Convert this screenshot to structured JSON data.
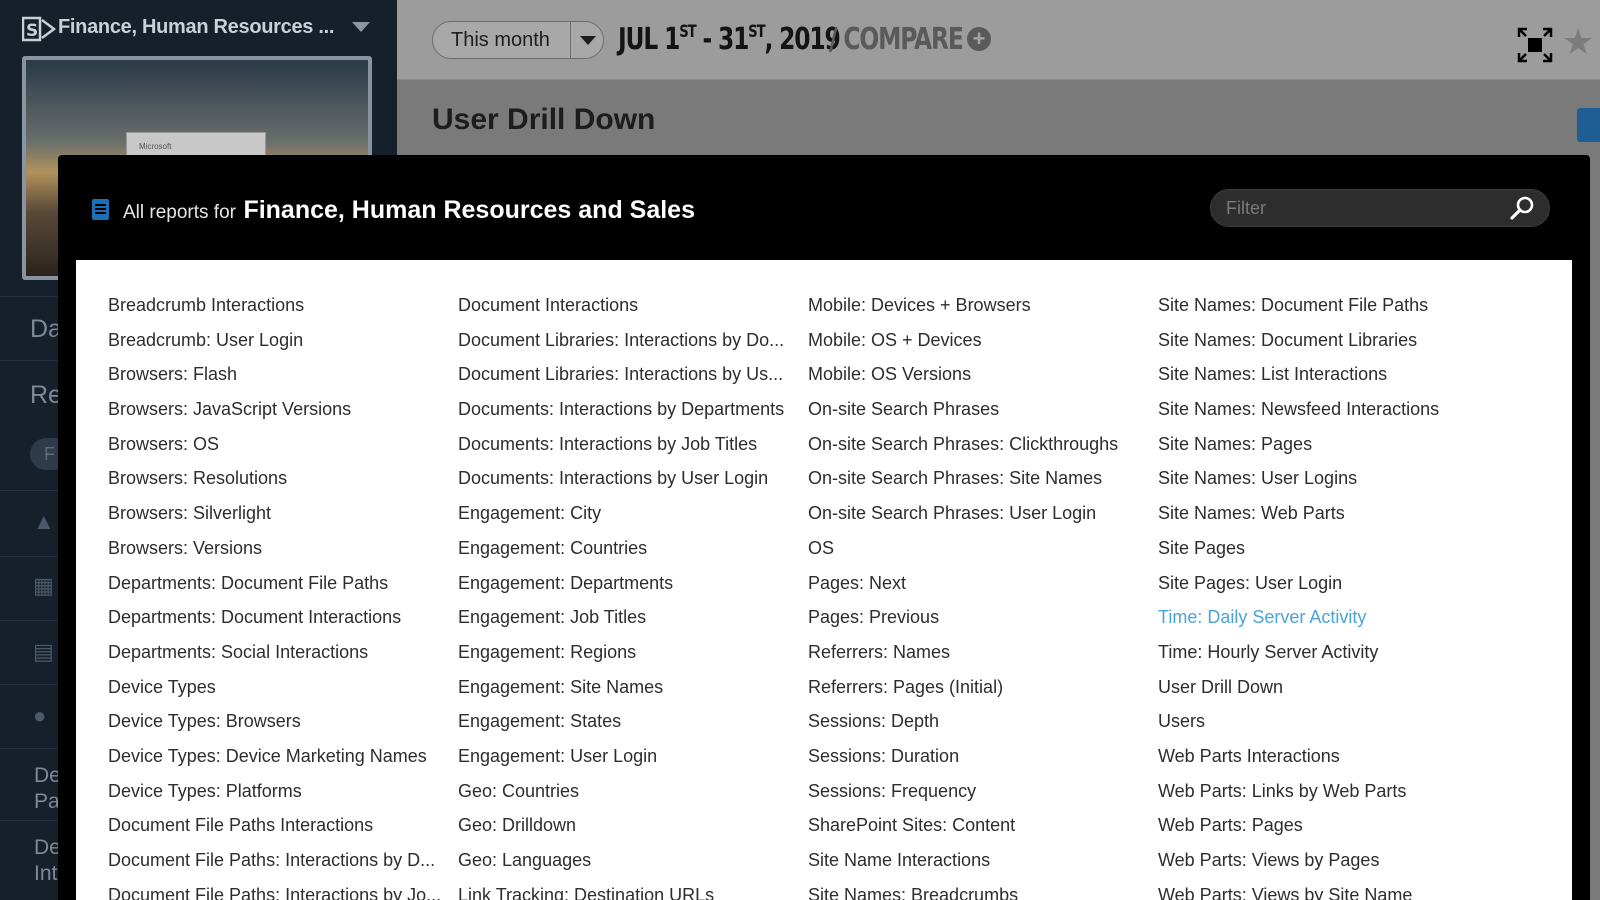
{
  "sidebar": {
    "site_title": "Finance, Human Resources ...",
    "thumb_caption": "Microsoft",
    "sections": [
      "Da",
      "Re"
    ],
    "search_pill": "F",
    "icons": [
      "flame-icon",
      "table-icon",
      "document-icon",
      "user-icon"
    ],
    "items": [
      {
        "line1": "De",
        "line2": "Pa"
      },
      {
        "line1": "De",
        "line2": "Int"
      }
    ]
  },
  "topbar": {
    "period": "This month",
    "date_parts": {
      "start": "JUL 1",
      "start_sup": "ST",
      "mid": " - 31",
      "end_sup": "ST",
      "end": ", 2019"
    },
    "compare_label": "/ COMPARE",
    "compare_icon": "+",
    "star_icon": "★"
  },
  "page": {
    "title": "User Drill Down"
  },
  "modal": {
    "title_prefix": "All reports for",
    "title_site": "Finance, Human Resources and Sales",
    "filter_placeholder": "Filter",
    "accent_color": "#4ba3dc",
    "active_report": "Time: Daily Server Activity",
    "columns": [
      [
        "Breadcrumb Interactions",
        "Breadcrumb: User Login",
        "Browsers: Flash",
        "Browsers: JavaScript Versions",
        "Browsers: OS",
        "Browsers: Resolutions",
        "Browsers: Silverlight",
        "Browsers: Versions",
        "Departments: Document File Paths",
        "Departments: Document Interactions",
        "Departments: Social Interactions",
        "Device Types",
        "Device Types: Browsers",
        "Device Types: Device Marketing Names",
        "Device Types: Platforms",
        "Document File Paths Interactions",
        "Document File Paths: Interactions by D...",
        "Document File Paths: Interactions by Jo..."
      ],
      [
        "Document Interactions",
        "Document Libraries: Interactions by Do...",
        "Document Libraries: Interactions by Us...",
        "Documents: Interactions by Departments",
        "Documents: Interactions by Job Titles",
        "Documents: Interactions by User Login",
        "Engagement: City",
        "Engagement: Countries",
        "Engagement: Departments",
        "Engagement: Job Titles",
        "Engagement: Regions",
        "Engagement: Site Names",
        "Engagement: States",
        "Engagement: User Login",
        "Geo: Countries",
        "Geo: Drilldown",
        "Geo: Languages",
        "Link Tracking: Destination URLs"
      ],
      [
        "Mobile: Devices + Browsers",
        "Mobile: OS + Devices",
        "Mobile: OS Versions",
        "On-site Search Phrases",
        "On-site Search Phrases: Clickthroughs",
        "On-site Search Phrases: Site Names",
        "On-site Search Phrases: User Login",
        "OS",
        "Pages: Next",
        "Pages: Previous",
        "Referrers: Names",
        "Referrers: Pages (Initial)",
        "Sessions: Depth",
        "Sessions: Duration",
        "Sessions: Frequency",
        "SharePoint Sites: Content",
        "Site Name Interactions",
        "Site Names: Breadcrumbs"
      ],
      [
        "Site Names: Document File Paths",
        "Site Names: Document Libraries",
        "Site Names: List Interactions",
        "Site Names: Newsfeed Interactions",
        "Site Names: Pages",
        "Site Names: User Logins",
        "Site Names: Web Parts",
        "Site Pages",
        "Site Pages: User Login",
        "Time: Daily Server Activity",
        "Time: Hourly Server Activity",
        "User Drill Down",
        "Users",
        "Web Parts Interactions",
        "Web Parts: Links by Web Parts",
        "Web Parts: Pages",
        "Web Parts: Views by Pages",
        "Web Parts: Views by Site Name"
      ]
    ]
  }
}
